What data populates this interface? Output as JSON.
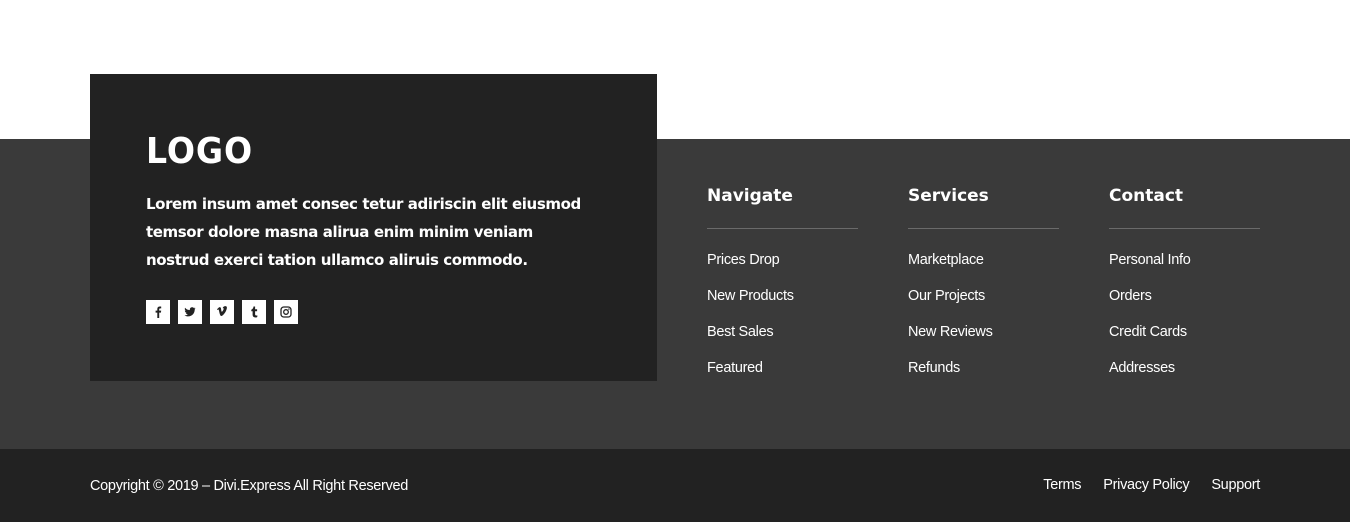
{
  "about": {
    "logo": "LOGO",
    "text": "Lorem insum amet consec tetur adiriscin elit eiusmod temsor dolore masna alirua enim minim veniam nostrud exerci tation ullamco aliruis commodo.",
    "socials": [
      {
        "icon": "facebook-icon",
        "glyph": "f"
      },
      {
        "icon": "twitter-icon"
      },
      {
        "icon": "vimeo-icon",
        "glyph": "v"
      },
      {
        "icon": "tumblr-icon",
        "glyph": "t"
      },
      {
        "icon": "instagram-icon"
      }
    ]
  },
  "columns": [
    {
      "title": "Navigate",
      "items": [
        "Prices Drop",
        "New Products",
        "Best Sales",
        "Featured"
      ]
    },
    {
      "title": "Services",
      "items": [
        "Marketplace",
        "Our Projects",
        "New Reviews",
        "Refunds"
      ]
    },
    {
      "title": "Contact",
      "items": [
        "Personal Info",
        "Orders",
        "Credit Cards",
        "Addresses"
      ]
    }
  ],
  "bottom": {
    "copyright": "Copyright © 2019 – Divi.Express All Right Reserved",
    "links": [
      "Terms",
      "Privacy Policy",
      "Support"
    ]
  },
  "colors": {
    "footer_main_bg": "#3a3a3a",
    "card_bg": "#222222",
    "bottom_bar_bg": "#222222",
    "text": "#ffffff",
    "rule": "#6a6a6a"
  }
}
